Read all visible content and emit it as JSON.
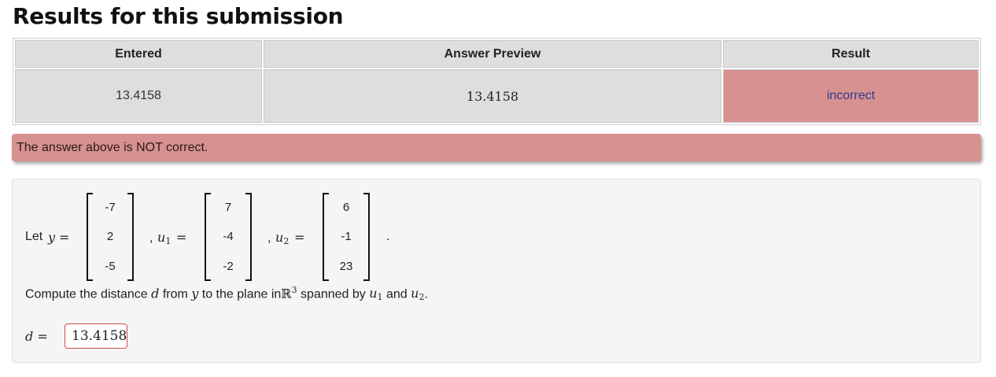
{
  "page": {
    "title": "Results for this submission"
  },
  "results_table": {
    "headers": [
      "Entered",
      "Answer Preview",
      "Result"
    ],
    "row": {
      "entered": "13.4158",
      "preview": "13.4158",
      "result": "incorrect"
    }
  },
  "alert": {
    "message": "The answer above is NOT correct."
  },
  "problem": {
    "let_text": "Let",
    "y_symbol": "y",
    "u_symbol": "u",
    "sub1": "1",
    "sub2": "2",
    "eq": "=",
    "comma": ",",
    "period": ".",
    "y": [
      "-7",
      "2",
      "-5"
    ],
    "u1": [
      "7",
      "-4",
      "-2"
    ],
    "u2": [
      "6",
      "-1",
      "23"
    ],
    "question_prefix": "Compute the distance",
    "d_symbol": "d",
    "question_from": "from",
    "question_mid": "to the plane in",
    "R_symbol": "ℝ",
    "R_exp": "3",
    "question_spanned": "spanned by",
    "and_text": "and",
    "answer_label": "d =",
    "answer_value": "13.4158"
  },
  "colors": {
    "incorrect": "#d79190",
    "result_text": "#2f3b8f"
  }
}
